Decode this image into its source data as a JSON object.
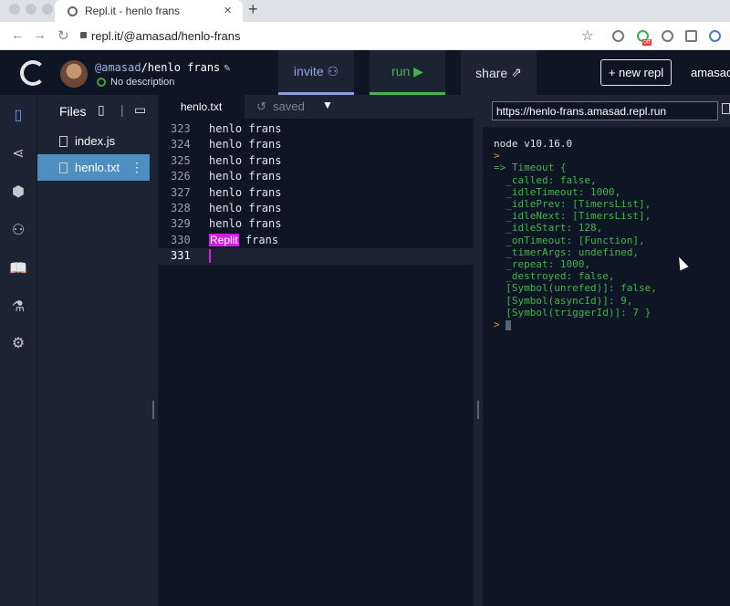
{
  "browser": {
    "tab_title": "Repl.it - henlo frans",
    "url": "repl.it/@amasad/henlo-frans",
    "ext_badge": "off"
  },
  "header": {
    "owner": "@amasad",
    "repl_name": "/henlo frans",
    "description": "No description",
    "invite_label": "invite",
    "run_label": "run",
    "share_label": "share",
    "new_repl_label": "+ new repl",
    "username": "amasad",
    "accent_invite": "#8f9fe1",
    "accent_run": "#47b34d"
  },
  "files": {
    "heading": "Files",
    "items": [
      {
        "name": "index.js"
      },
      {
        "name": "henlo.txt"
      }
    ]
  },
  "editor": {
    "tab": "henlo.txt",
    "status": "saved",
    "lines": [
      {
        "num": "323",
        "text": "henlo frans"
      },
      {
        "num": "324",
        "text": "henlo frans"
      },
      {
        "num": "325",
        "text": "henlo frans"
      },
      {
        "num": "326",
        "text": "henlo frans"
      },
      {
        "num": "327",
        "text": "henlo frans"
      },
      {
        "num": "328",
        "text": "henlo frans"
      },
      {
        "num": "329",
        "text": "henlo frans"
      },
      {
        "num": "330",
        "text": "frans",
        "label": "Replit"
      },
      {
        "num": "331",
        "text": ""
      }
    ],
    "cursor_label_color": "#d51ce0"
  },
  "console": {
    "url": "https://henlo-frans.amasad.repl.run",
    "version": "node v10.16.0",
    "prompt": ">",
    "output": [
      "=> Timeout {",
      "  _called: false,",
      "  _idleTimeout: 1000,",
      "  _idlePrev: [TimersList],",
      "  _idleNext: [TimersList],",
      "  _idleStart: 128,",
      "  _onTimeout: [Function],",
      "  _timerArgs: undefined,",
      "  _repeat: 1000,",
      "  _destroyed: false,",
      "  [Symbol(unrefed)]: false,",
      "  [Symbol(asyncId)]: 9,",
      "  [Symbol(triggerId)]: 7 }"
    ]
  }
}
